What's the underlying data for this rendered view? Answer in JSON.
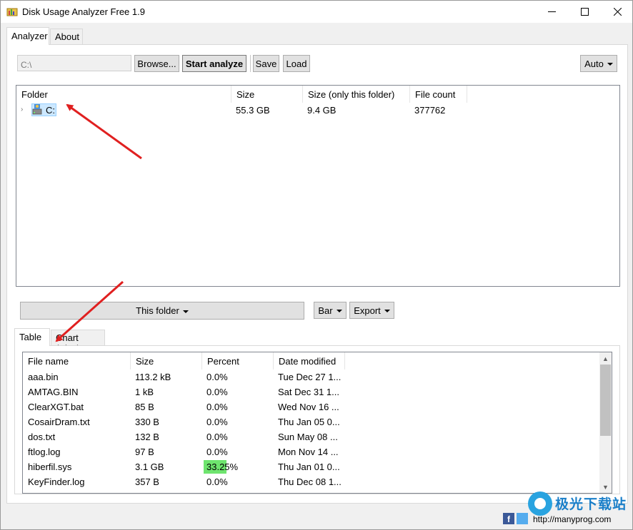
{
  "window": {
    "title": "Disk Usage Analyzer Free 1.9"
  },
  "tabs": [
    {
      "label": "Analyzer"
    },
    {
      "label": "About"
    }
  ],
  "toolbar": {
    "path_value": "C:\\",
    "browse_label": "Browse...",
    "start_label": "Start analyze",
    "save_label": "Save",
    "load_label": "Load",
    "auto_label": "Auto"
  },
  "tree": {
    "columns": [
      "Folder",
      "Size",
      "Size (only this folder)",
      "File count"
    ],
    "rows": [
      {
        "name": "C:",
        "size": "55.3 GB",
        "size_only": "9.4 GB",
        "count": "377762"
      }
    ]
  },
  "lower_toolbar": {
    "this_folder_label": "This folder",
    "bar_label": "Bar",
    "export_label": "Export"
  },
  "lower_tabs": [
    {
      "label": "Table"
    },
    {
      "label": "Chart (Size)"
    }
  ],
  "files": {
    "columns": [
      "File name",
      "Size",
      "Percent",
      "Date modified"
    ],
    "rows": [
      {
        "name": "aaa.bin",
        "size": "113.2 kB",
        "percent": "0.0%",
        "pct": 0,
        "date": "Tue Dec 27 1..."
      },
      {
        "name": "AMTAG.BIN",
        "size": "1 kB",
        "percent": "0.0%",
        "pct": 0,
        "date": "Sat Dec 31 1..."
      },
      {
        "name": "ClearXGT.bat",
        "size": "85 B",
        "percent": "0.0%",
        "pct": 0,
        "date": "Wed Nov 16 ..."
      },
      {
        "name": "CosairDram.txt",
        "size": "330 B",
        "percent": "0.0%",
        "pct": 0,
        "date": "Thu Jan 05 0..."
      },
      {
        "name": "dos.txt",
        "size": "132 B",
        "percent": "0.0%",
        "pct": 0,
        "date": "Sun May 08 ..."
      },
      {
        "name": "ftlog.log",
        "size": "97 B",
        "percent": "0.0%",
        "pct": 0,
        "date": "Mon Nov 14 ..."
      },
      {
        "name": "hiberfil.sys",
        "size": "3.1 GB",
        "percent": "33.25%",
        "pct": 33.25,
        "date": "Thu Jan 01 0..."
      },
      {
        "name": "KeyFinder.log",
        "size": "357 B",
        "percent": "0.0%",
        "pct": 0,
        "date": "Thu Dec 08 1..."
      }
    ]
  },
  "footer": {
    "facebook_icon": "f",
    "link_text": "http://manyprog.com",
    "watermark_text": "极光下载站"
  },
  "colors": {
    "percent_bar": "#6ee46e",
    "selection": "#cce8ff",
    "arrow": "#e02020"
  },
  "icons": {
    "app": "folder-chart-icon",
    "drive": "drive-icon",
    "facebook": "facebook-icon",
    "twitter": "twitter-icon"
  }
}
